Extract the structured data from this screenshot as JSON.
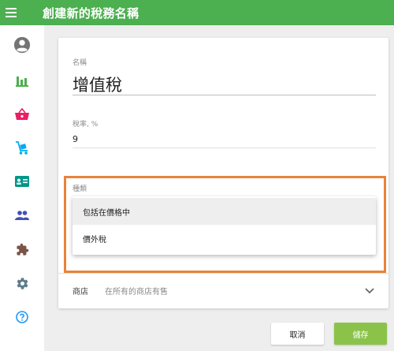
{
  "header": {
    "title": "創建新的稅務名稱",
    "menu_icon": "menu-icon",
    "background": "#4caf50"
  },
  "sidebar": {
    "items": [
      {
        "icon": "account-circle-icon",
        "color": "#757575"
      },
      {
        "icon": "bar-chart-icon",
        "color": "#4caf50"
      },
      {
        "icon": "shopping-basket-icon",
        "color": "#e91e63"
      },
      {
        "icon": "cart-icon",
        "color": "#03a9f4"
      },
      {
        "icon": "id-card-icon",
        "color": "#009688"
      },
      {
        "icon": "people-icon",
        "color": "#3f51b5"
      },
      {
        "icon": "puzzle-icon",
        "color": "#795548"
      },
      {
        "icon": "settings-icon",
        "color": "#607d8b"
      },
      {
        "icon": "help-icon",
        "color": "#2196f3"
      }
    ]
  },
  "form": {
    "name_label": "名稱",
    "name_value": "增值稅",
    "rate_label": "稅率, %",
    "rate_value": "9",
    "type_label": "種類",
    "type_options": [
      "包括在價格中",
      "價外稅"
    ],
    "type_selected_index": 0,
    "store_label": "商店",
    "store_value": "在所有的商店有售"
  },
  "actions": {
    "cancel_label": "取消",
    "save_label": "儲存",
    "save_color": "#8bc34a"
  },
  "annotation": {
    "highlight_color": "#e8833a"
  }
}
